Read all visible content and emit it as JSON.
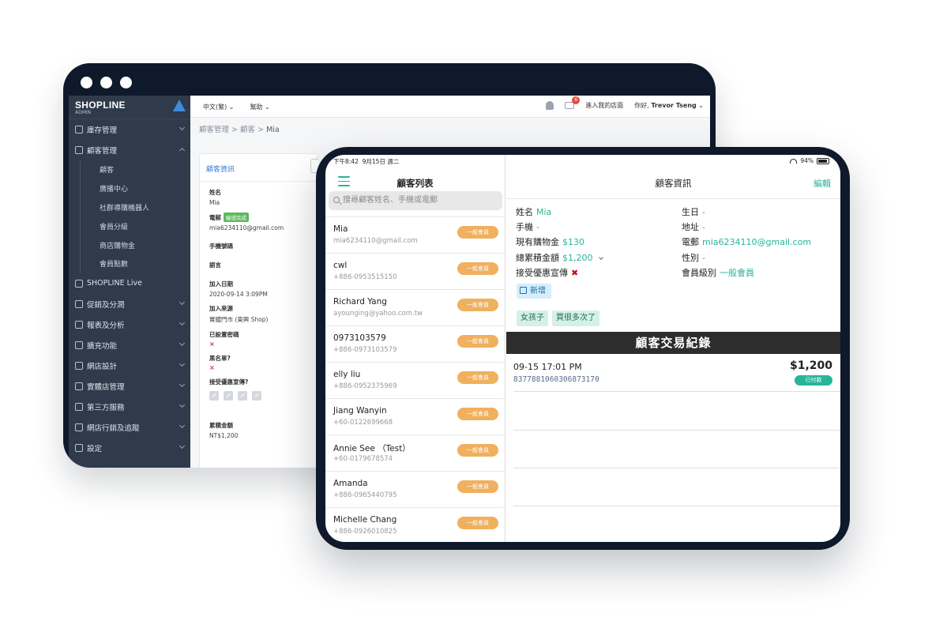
{
  "admin": {
    "logo": {
      "name": "SHOPLINE",
      "sub": "ADMIN"
    },
    "sidebar": {
      "items": [
        {
          "label": "庫存管理",
          "icon": "inventory-icon",
          "chev": "down"
        },
        {
          "label": "顧客管理",
          "icon": "user-icon",
          "chev": "up"
        }
      ],
      "sub_items": [
        "顧客",
        "廣播中心",
        "社群導購機器人",
        "會員分級",
        "商店購物金",
        "會員點數"
      ],
      "items2": [
        {
          "label": "SHOPLINE Live",
          "icon": "live-icon",
          "chev": ""
        },
        {
          "label": "促銷及分潤",
          "icon": "tag-icon",
          "chev": "down"
        },
        {
          "label": "報表及分析",
          "icon": "chart-icon",
          "chev": "down"
        },
        {
          "label": "擴充功能",
          "icon": "apps-icon",
          "chev": "down"
        },
        {
          "label": "網店設計",
          "icon": "paint-icon",
          "chev": "down"
        },
        {
          "label": "實體店管理",
          "icon": "store-icon",
          "chev": "down"
        },
        {
          "label": "第三方服務",
          "icon": "plugin-icon",
          "chev": "down"
        },
        {
          "label": "網店行銷及追蹤",
          "icon": "target-icon",
          "chev": "down"
        },
        {
          "label": "設定",
          "icon": "gear-icon",
          "chev": "down"
        }
      ]
    },
    "topbar": {
      "language": "中文(繁)",
      "help": "幫助",
      "notification_count": "6",
      "enter_store": "進入我的店面",
      "greeting": "你好,",
      "user_name": "Trevor Tseng"
    },
    "breadcrumb": {
      "a": "顧客管理",
      "sep": ">",
      "b": "顧客",
      "c": "Mia"
    },
    "card": {
      "title": "顧客資訊",
      "name_label": "姓名",
      "name_value": "Mia",
      "email_label": "電郵",
      "email_badge": "驗證完成",
      "email_value": "mia6234110@gmail.com",
      "phone_label": "手機號碼",
      "lang_label": "語言",
      "join_label": "加入日期",
      "join_value": "2020-09-14 3:09PM",
      "source_label": "加入來源",
      "source_value": "實體門市 (東興 Shop)",
      "pwd_label": "已設置密碼",
      "blacklist_label": "黑名單?",
      "promo_label": "接受優惠宣傳?",
      "total_label": "累積金額",
      "total_value": "NT$1,200",
      "x_mark": "×"
    }
  },
  "tablet": {
    "status": {
      "time": "下午8:42",
      "date": "9月15日 週二",
      "battery": "94%",
      "battery_level": 0.94
    },
    "list": {
      "title": "顧客列表",
      "search_placeholder": "搜尋顧客姓名、手機或電郵",
      "customers": [
        {
          "name": "Mia",
          "sub": "mia6234110@gmail.com",
          "tier": "一般會員"
        },
        {
          "name": "cwl",
          "sub": "+886-0953515150",
          "tier": "一般會員"
        },
        {
          "name": "Richard Yang",
          "sub": "ayounging@yahoo.com.tw",
          "tier": "一般會員"
        },
        {
          "name": "0973103579",
          "sub": "+886-0973103579",
          "tier": "一般會員"
        },
        {
          "name": "elly liu",
          "sub": "+886-0952375969",
          "tier": "一般會員"
        },
        {
          "name": "Jiang Wanyin",
          "sub": "+60-0122699668",
          "tier": "一般會員"
        },
        {
          "name": "Annie See （Test）",
          "sub": "+60-0179678574",
          "tier": "一般會員"
        },
        {
          "name": "Amanda",
          "sub": "+886-0965440795",
          "tier": "一般會員"
        },
        {
          "name": "Michelle Chang",
          "sub": "+886-0926010825",
          "tier": "一般會員"
        }
      ]
    },
    "detail": {
      "title": "顧客資訊",
      "edit": "編輯",
      "left": [
        {
          "label": "姓名",
          "value": "Mia"
        },
        {
          "label": "手機",
          "value": "-"
        },
        {
          "label": "現有購物金",
          "value": "$130"
        },
        {
          "label": "總累積金額",
          "value": "$1,200"
        },
        {
          "label": "接受優惠宣傳",
          "value": "✖"
        }
      ],
      "right": [
        {
          "label": "生日",
          "value": "-"
        },
        {
          "label": "地址",
          "value": "-"
        },
        {
          "label": "電郵",
          "value": "mia6234110@gmail.com"
        },
        {
          "label": "性別",
          "value": "-"
        },
        {
          "label": "會員級別",
          "value": "一般會員"
        }
      ],
      "add_label": "新增",
      "tags": [
        "女孩子",
        "買很多次了"
      ],
      "tx_title": "顧客交易紀錄",
      "transactions": [
        {
          "datetime": "09-15 17:01 PM",
          "order_id": "8377881060306873170",
          "amount": "$1,200",
          "status": "已付款"
        }
      ]
    }
  }
}
